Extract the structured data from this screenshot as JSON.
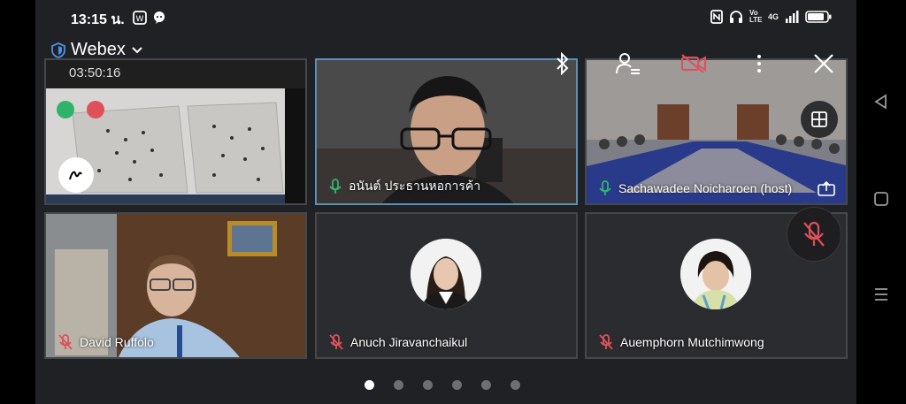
{
  "status_bar": {
    "time": "13:15 น.",
    "network": "4G",
    "lte": "Vo LTE"
  },
  "app": {
    "title": "Webex",
    "timer": "03:50:16"
  },
  "participants": [
    {
      "name": "",
      "muted": false
    },
    {
      "name": "อนันต์ ประธานหอการค้า",
      "muted": false
    },
    {
      "name": "Sachawadee Noicharoen (host)",
      "muted": false
    },
    {
      "name": "David Ruffolo",
      "muted": true
    },
    {
      "name": "Anuch Jiravanchaikul",
      "muted": true
    },
    {
      "name": "Auemphorn Mutchimwong",
      "muted": true
    }
  ],
  "paging": {
    "page_count": 6,
    "active_page": 1
  },
  "colors": {
    "screen_bg": "#202124",
    "tile_bg": "#2b2c2f",
    "muted_red": "#e0505a",
    "unmuted_green": "#2fb36a",
    "active_border": "#5a8fb8"
  },
  "icons": {
    "shield": "shield-icon",
    "chevron": "chevron-down-icon",
    "bluetooth": "bluetooth-icon",
    "participants": "participants-list-icon",
    "video_off": "video-off-icon",
    "more": "more-vertical-icon",
    "close": "close-icon"
  }
}
